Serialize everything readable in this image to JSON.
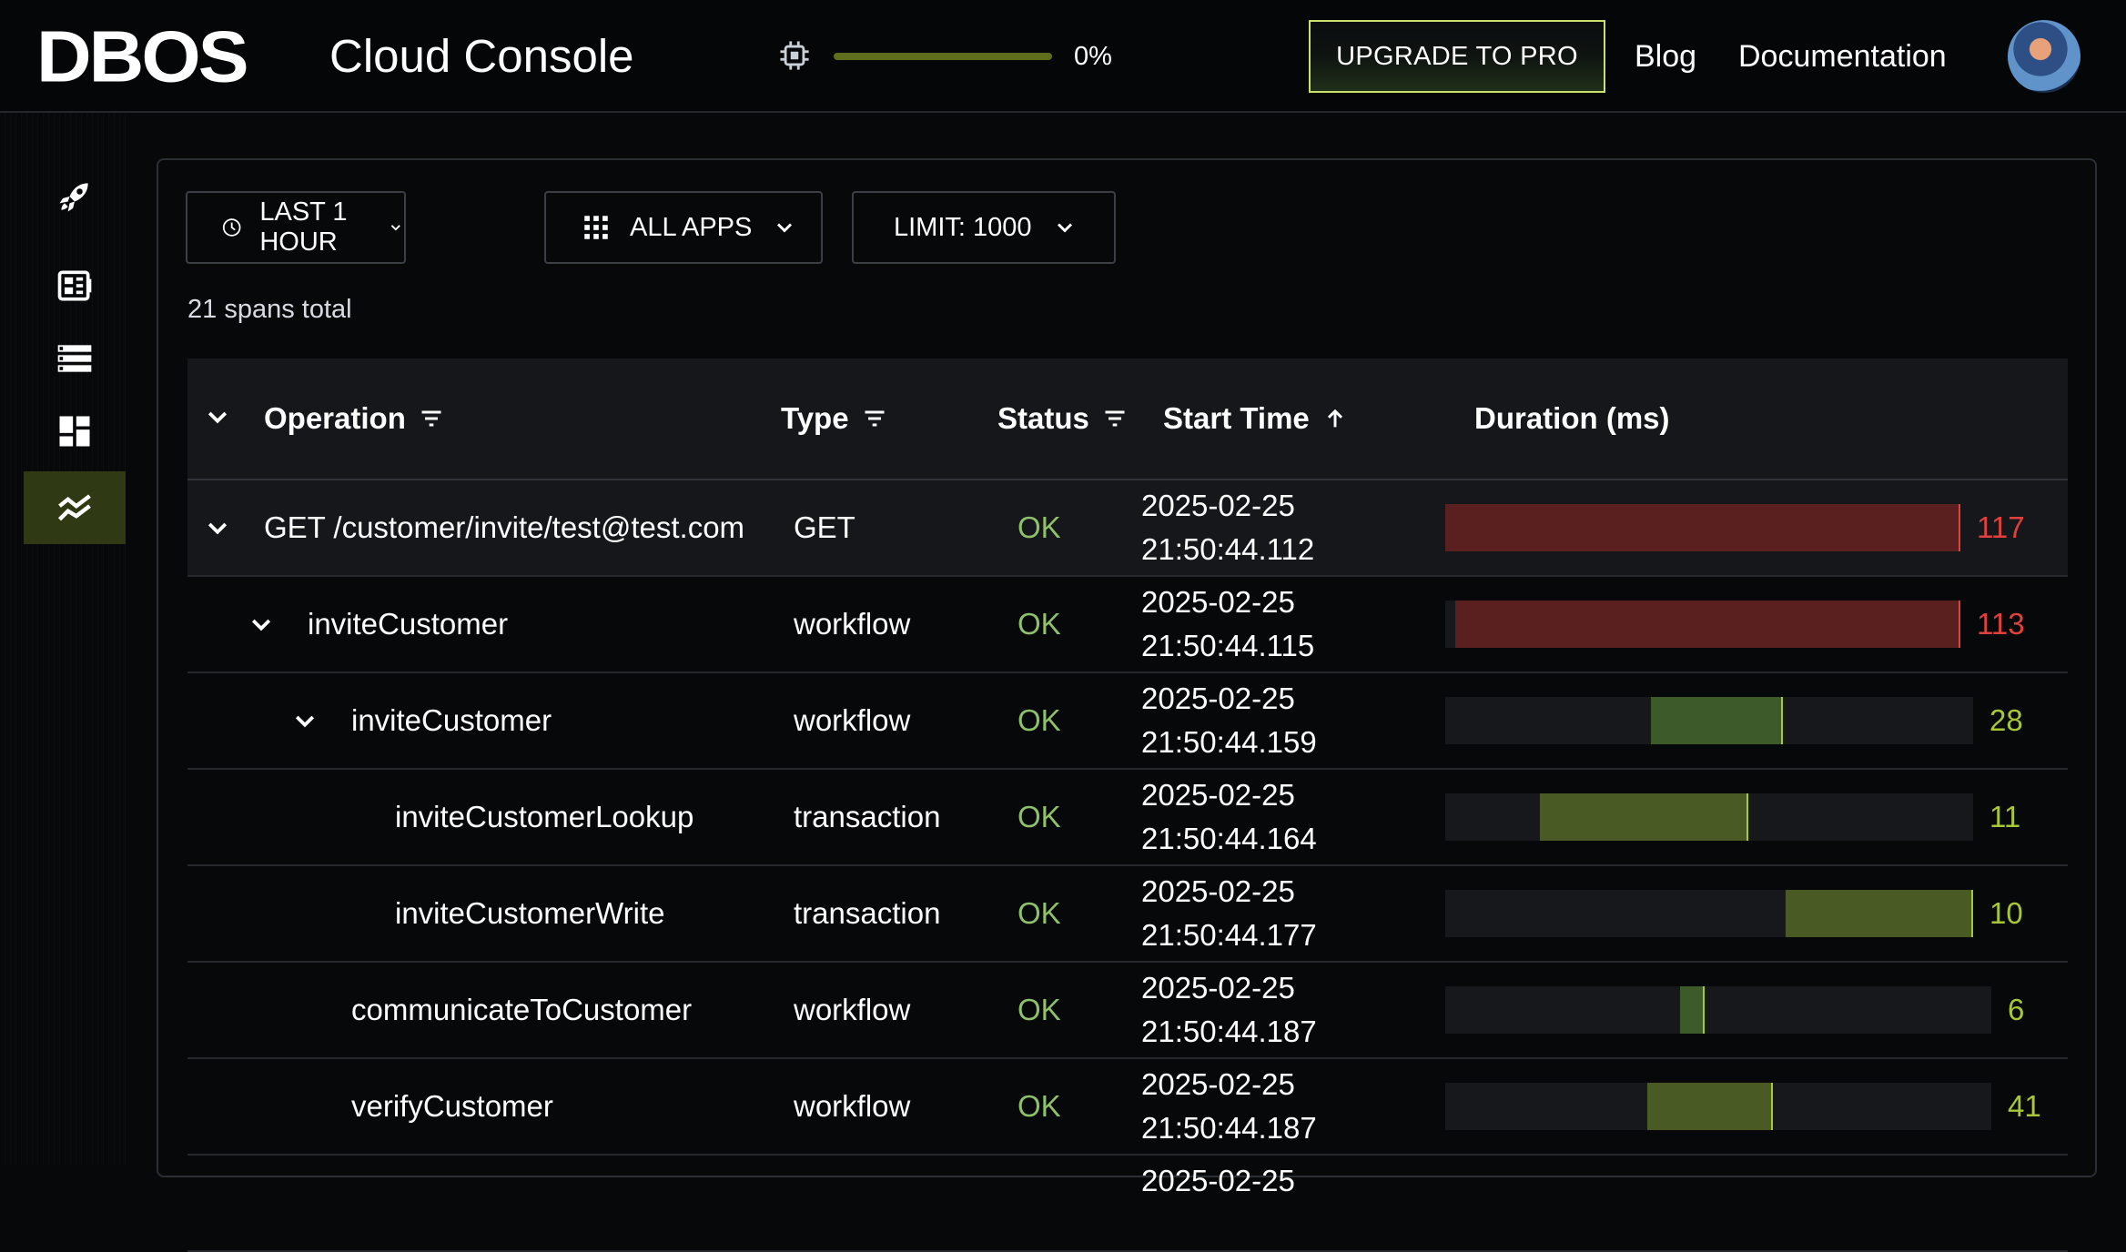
{
  "header": {
    "logo": "DBOS",
    "product": "Cloud Console",
    "usage_percent": "0%",
    "usage_fraction": 0,
    "upgrade_label": "UPGRADE TO PRO",
    "links": [
      "Blog",
      "Documentation"
    ]
  },
  "sidebar": {
    "items": [
      {
        "icon": "rocket-icon"
      },
      {
        "icon": "apps-icon"
      },
      {
        "icon": "database-icon"
      },
      {
        "icon": "dashboard-icon"
      },
      {
        "icon": "traces-icon",
        "active": true
      }
    ]
  },
  "filters": {
    "time_range": "LAST 1 HOUR",
    "apps": "ALL APPS",
    "limit": "LIMIT: 1000"
  },
  "summary": "21 spans total",
  "table": {
    "columns": [
      "Operation",
      "Type",
      "Status",
      "Start Time",
      "Duration (ms)"
    ],
    "rows": [
      {
        "operation": "GET /customer/invite/test@test.com",
        "type": "GET",
        "status": "OK",
        "date": "2025-02-25",
        "time": "21:50:44.112",
        "duration": "117",
        "depth": 0,
        "expandable": true
      },
      {
        "operation": "inviteCustomer",
        "type": "workflow",
        "status": "OK",
        "date": "2025-02-25",
        "time": "21:50:44.115",
        "duration": "113",
        "depth": 1,
        "expandable": true
      },
      {
        "operation": "inviteCustomer",
        "type": "workflow",
        "status": "OK",
        "date": "2025-02-25",
        "time": "21:50:44.159",
        "duration": "28",
        "depth": 2,
        "expandable": true
      },
      {
        "operation": "inviteCustomerLookup",
        "type": "transaction",
        "status": "OK",
        "date": "2025-02-25",
        "time": "21:50:44.164",
        "duration": "11",
        "depth": 3,
        "expandable": false
      },
      {
        "operation": "inviteCustomerWrite",
        "type": "transaction",
        "status": "OK",
        "date": "2025-02-25",
        "time": "21:50:44.177",
        "duration": "10",
        "depth": 3,
        "expandable": false
      },
      {
        "operation": "communicateToCustomer",
        "type": "workflow",
        "status": "OK",
        "date": "2025-02-25",
        "time": "21:50:44.187",
        "duration": "6",
        "depth": 2,
        "expandable": false
      },
      {
        "operation": "verifyCustomer",
        "type": "workflow",
        "status": "OK",
        "date": "2025-02-25",
        "time": "21:50:44.187",
        "duration": "41",
        "depth": 2,
        "expandable": false
      },
      {
        "operation": "",
        "type": "",
        "status": "",
        "date": "2025-02-25",
        "time": "",
        "duration": "",
        "depth": 2,
        "expandable": false
      }
    ]
  },
  "colors": {
    "accent": "#a7c737",
    "long_span": "#5a1f1f",
    "long_span_text": "#e0413c",
    "workflow_span": "#3d5a2b",
    "transaction_span": "#4a5a24",
    "short_span_text": "#a7c737",
    "ok": "#8fc06a"
  }
}
